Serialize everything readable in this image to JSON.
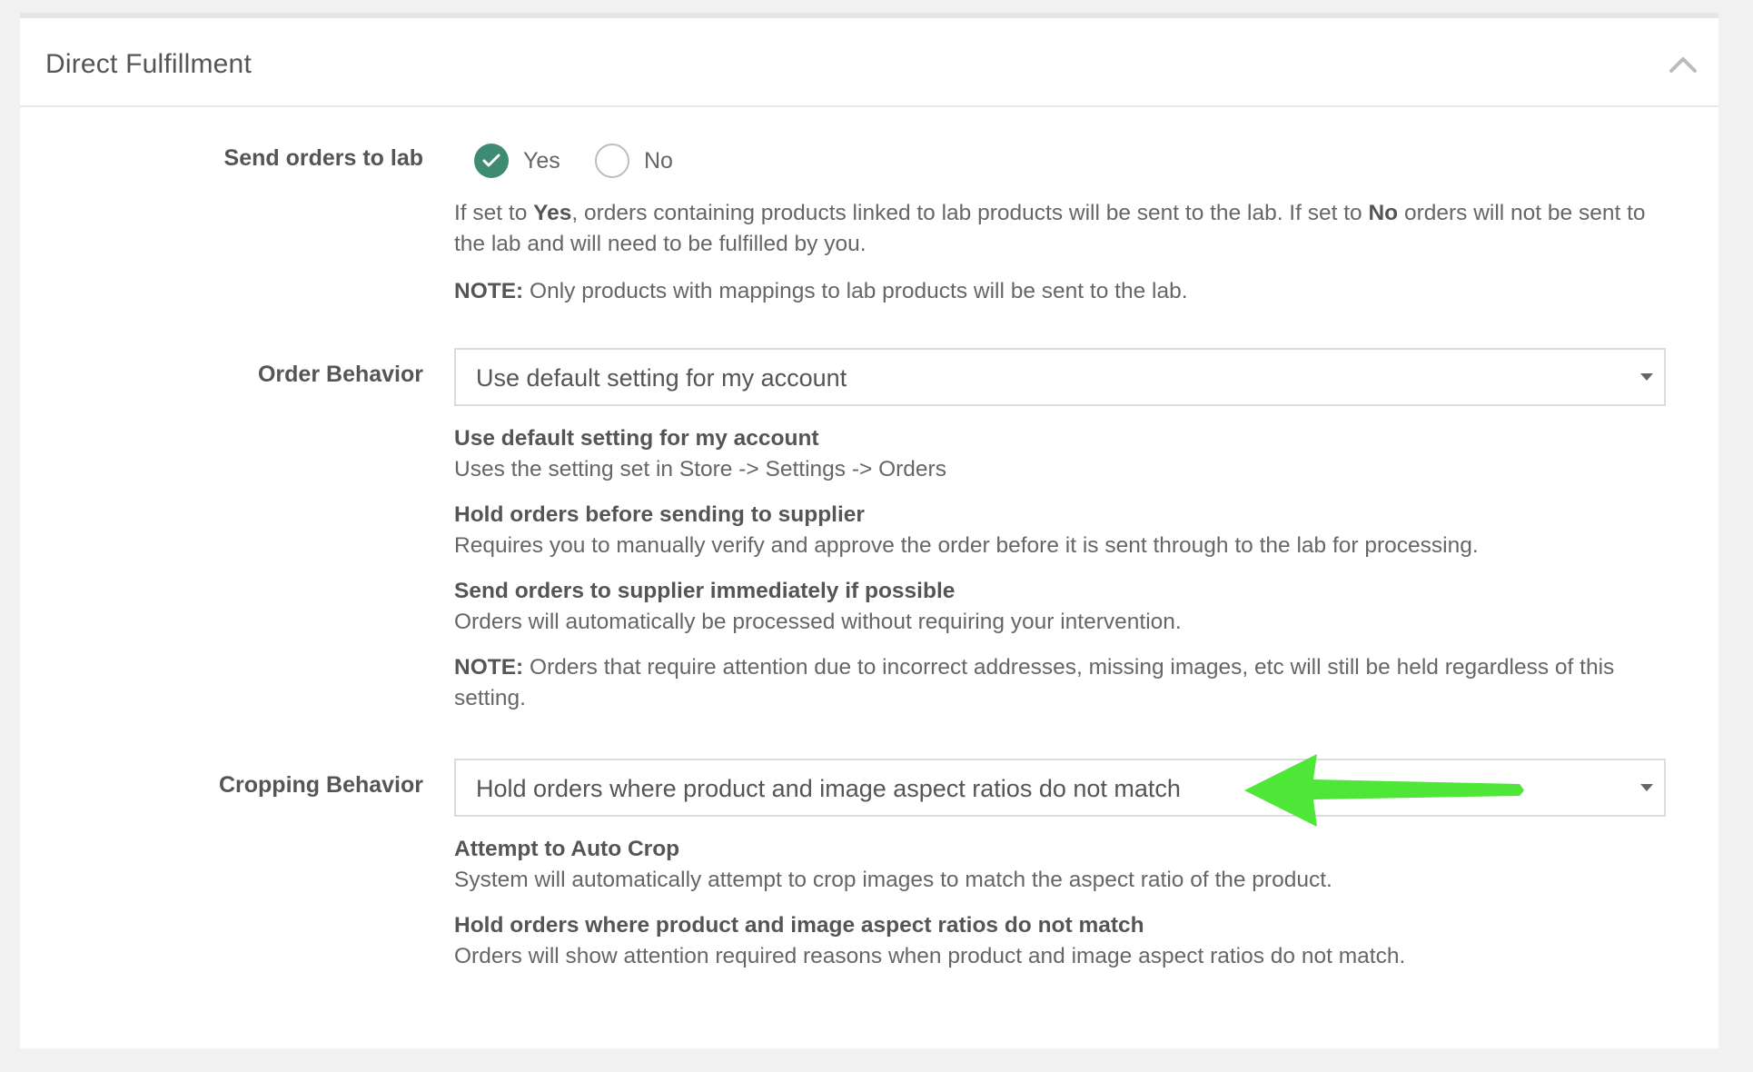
{
  "panel": {
    "title": "Direct Fulfillment"
  },
  "send_orders": {
    "label": "Send orders to lab",
    "yes_label": "Yes",
    "no_label": "No",
    "selected": "Yes",
    "desc_pre": "If set to ",
    "desc_yes": "Yes",
    "desc_mid": ", orders containing products linked to lab products will be sent to the lab. If set to ",
    "desc_no": "No",
    "desc_post": " orders will not be sent to the lab and will need to be fulfilled by you.",
    "note_label": "NOTE:",
    "note_text": " Only products with mappings to lab products will be sent to the lab."
  },
  "order_behavior": {
    "label": "Order Behavior",
    "selected": "Use default setting for my account",
    "options": [
      {
        "title": "Use default setting for my account",
        "desc": "Uses the setting set in Store -> Settings -> Orders"
      },
      {
        "title": "Hold orders before sending to supplier",
        "desc": "Requires you to manually verify and approve the order before it is sent through to the lab for processing."
      },
      {
        "title": "Send orders to supplier immediately if possible",
        "desc": "Orders will automatically be processed without requiring your intervention."
      }
    ],
    "note_label": "NOTE:",
    "note_text": " Orders that require attention due to incorrect addresses, missing images, etc will still be held regardless of this setting."
  },
  "cropping_behavior": {
    "label": "Cropping Behavior",
    "selected": "Hold orders where product and image aspect ratios do not match",
    "options": [
      {
        "title": "Attempt to Auto Crop",
        "desc": "System will automatically attempt to crop images to match the aspect ratio of the product."
      },
      {
        "title": "Hold orders where product and image aspect ratios do not match",
        "desc": "Orders will show attention required reasons when product and image aspect ratios do not match."
      }
    ]
  },
  "icons": {
    "collapse": "chevron-up-icon",
    "check": "check-icon",
    "caret": "caret-down-icon",
    "annotation": "green-arrow"
  },
  "colors": {
    "accent": "#3f8a72",
    "annotation_arrow": "#4ee637"
  }
}
